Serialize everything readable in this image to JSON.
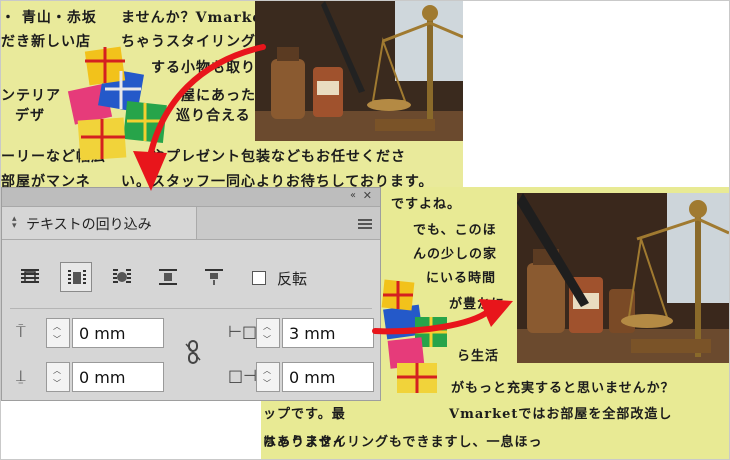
{
  "panel": {
    "tab_label": "テキストの回り込み",
    "tab_arrow": "⌃⌄",
    "collapse": "‹‹",
    "close": "✕",
    "invert_label": "反転",
    "top_offset": "0 mm",
    "bottom_offset": "0 mm",
    "left_offset": "3 mm",
    "right_offset": "0 mm"
  },
  "doc_before": {
    "lines": [
      "・ 青山・赤坂",
      "だき新しい店",
      "ンテリア",
      "デザ",
      "ーリーなど幅広",
      "部屋がマンネ",
      "ませんか？Vmarket",
      "ちゃうスタイリング",
      "する小物も取り",
      "屋にあった",
      "巡り合える",
      "やプレゼント包装などもお任せくださ",
      "い。スタッフ一同心よりお待ちしております。"
    ]
  },
  "doc_after": {
    "lines": [
      "ですよね。",
      "でも、このほ",
      "んの少しの家",
      "にいる時間",
      "が豊かに",
      "ら生活",
      "がもっと充実すると思いませんか？",
      "Vmarketではお部屋を全部改造し",
      "ちゃうスタイリングもできますし、一息ほっ",
      "ップです。最",
      "はありません"
    ]
  },
  "colors": {
    "doc_bg": "#e9ea9b",
    "arrow": "#e8151b",
    "panel_bg": "#d6d6d6"
  }
}
